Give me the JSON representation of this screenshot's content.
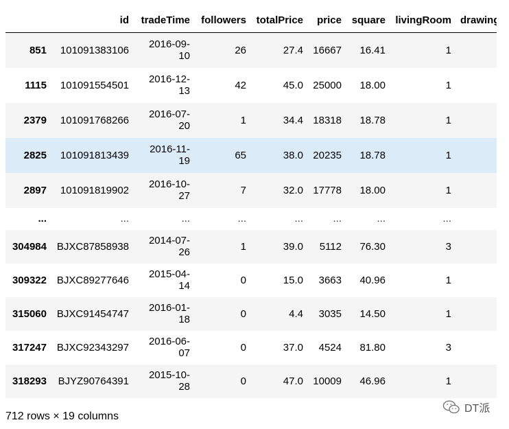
{
  "table": {
    "columns": [
      "",
      "id",
      "tradeTime",
      "followers",
      "totalPrice",
      "price",
      "square",
      "livingRoom",
      "drawingRoom"
    ],
    "rows": [
      {
        "index": "851",
        "id": "101091383106",
        "tradeTime_a": "2016-09-",
        "tradeTime_b": "10",
        "followers": "26",
        "totalPrice": "27.4",
        "price": "16667",
        "square": "16.41",
        "livingRoom": "1"
      },
      {
        "index": "1115",
        "id": "101091554501",
        "tradeTime_a": "2016-12-",
        "tradeTime_b": "13",
        "followers": "42",
        "totalPrice": "45.0",
        "price": "25000",
        "square": "18.00",
        "livingRoom": "1"
      },
      {
        "index": "2379",
        "id": "101091768266",
        "tradeTime_a": "2016-07-",
        "tradeTime_b": "20",
        "followers": "1",
        "totalPrice": "34.4",
        "price": "18318",
        "square": "18.78",
        "livingRoom": "1"
      },
      {
        "index": "2825",
        "id": "101091813439",
        "tradeTime_a": "2016-11-",
        "tradeTime_b": "19",
        "followers": "65",
        "totalPrice": "38.0",
        "price": "20235",
        "square": "18.78",
        "livingRoom": "1"
      },
      {
        "index": "2897",
        "id": "101091819902",
        "tradeTime_a": "2016-10-",
        "tradeTime_b": "27",
        "followers": "7",
        "totalPrice": "32.0",
        "price": "17778",
        "square": "18.00",
        "livingRoom": "1"
      },
      {
        "index": "304984",
        "id": "BJXC87858938",
        "tradeTime_a": "2014-07-",
        "tradeTime_b": "26",
        "followers": "1",
        "totalPrice": "39.0",
        "price": "5112",
        "square": "76.30",
        "livingRoom": "3"
      },
      {
        "index": "309322",
        "id": "BJXC89277646",
        "tradeTime_a": "2015-04-",
        "tradeTime_b": "14",
        "followers": "0",
        "totalPrice": "15.0",
        "price": "3663",
        "square": "40.96",
        "livingRoom": "1"
      },
      {
        "index": "315060",
        "id": "BJXC91454747",
        "tradeTime_a": "2016-01-",
        "tradeTime_b": "18",
        "followers": "0",
        "totalPrice": "4.4",
        "price": "3035",
        "square": "14.50",
        "livingRoom": "1"
      },
      {
        "index": "317247",
        "id": "BJXC92343297",
        "tradeTime_a": "2016-06-",
        "tradeTime_b": "07",
        "followers": "0",
        "totalPrice": "37.0",
        "price": "4524",
        "square": "81.80",
        "livingRoom": "3"
      },
      {
        "index": "318293",
        "id": "BJYZ90764391",
        "tradeTime_a": "2015-10-",
        "tradeTime_b": "28",
        "followers": "0",
        "totalPrice": "47.0",
        "price": "10009",
        "square": "46.96",
        "livingRoom": "1"
      }
    ],
    "ellipsis": "...",
    "ellipsis_index": "..."
  },
  "summary": "712 rows × 19 columns",
  "watermark": {
    "text": "DT派",
    "icon": "wechat-icon"
  },
  "colors": {
    "hover_row": "#dcebf8",
    "stripe_row": "#f5f5f5"
  }
}
